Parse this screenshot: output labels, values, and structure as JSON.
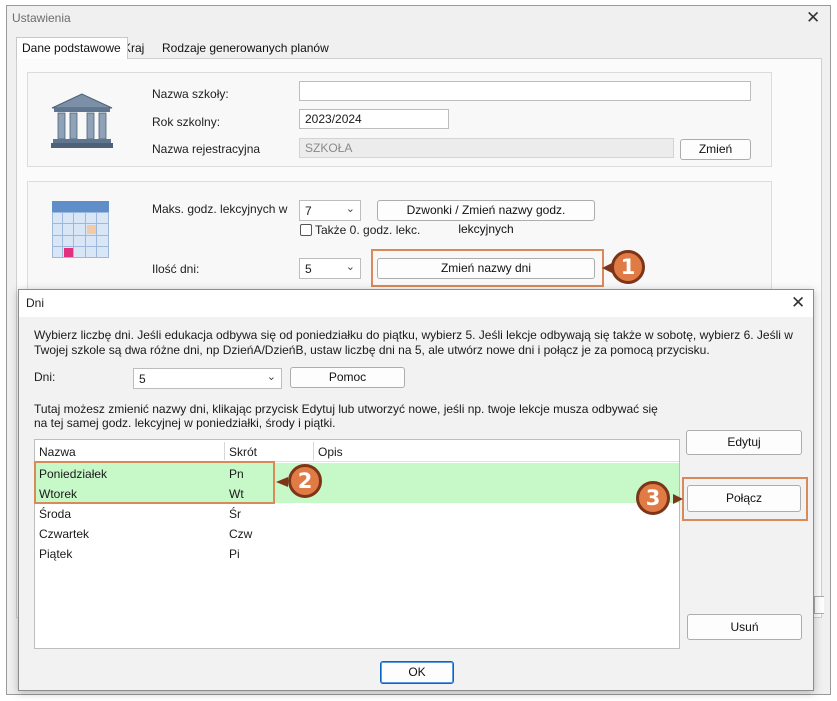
{
  "window": {
    "title": "Ustawienia",
    "close_glyph": "✕"
  },
  "tabs": [
    {
      "label": "Dane podstawowe",
      "active": true
    },
    {
      "label": "Kraj",
      "active": false
    },
    {
      "label": "Rodzaje generowanych planów",
      "active": false
    }
  ],
  "school_group": {
    "name_label": "Nazwa szkoły:",
    "name_value": "",
    "year_label": "Rok szkolny:",
    "year_value": "2023/2024",
    "reg_label": "Nazwa rejestracyjna",
    "reg_value": "SZKOŁA",
    "change_button": "Zmień",
    "icon": "building-icon"
  },
  "lessons_group": {
    "icon": "calendar-grid-icon",
    "max_label": "Maks. godz. lekcyjnych w",
    "max_value": "7",
    "bells_button": "Dzwonki / Zmień nazwy godz. lekcyjnych",
    "zero_checkbox_label": "Także 0. godz. lekc.",
    "zero_checked": false,
    "days_label": "Ilość dni:",
    "days_value": "5",
    "rename_days_button": "Zmień nazwy dni"
  },
  "annotations": {
    "badge1": "1",
    "badge2": "2",
    "badge3": "3",
    "accent_color": "#e07b45"
  },
  "dialog": {
    "title": "Dni",
    "close_glyph": "✕",
    "instructions": "Wybierz liczbę dni. Jeśli edukacja odbywa się od poniedziałku do piątku, wybierz 5. Jeśli lekcje odbywają się także w sobotę, wybierz 6. Jeśli w Twojej szkole są dwa różne dni, np DzieńA/DzieńB, ustaw liczbę dni na 5, ale utwórz nowe dni i połącz je za pomocą przycisku.",
    "days_label": "Dni:",
    "days_value": "5",
    "help_button": "Pomoc",
    "rename_hint": "Tutaj możesz zmienić nazwy dni, klikając przycisk Edytuj lub utworzyć nowe, jeśli np. twoje lekcje musza odbywać się na tej samej godz. lekcyjnej w poniedziałki, środy i piątki.",
    "columns": [
      "Nazwa",
      "Skrót",
      "Opis"
    ],
    "rows": [
      {
        "name": "Poniedziałek",
        "short": "Pn",
        "desc": "",
        "selected": true
      },
      {
        "name": "Wtorek",
        "short": "Wt",
        "desc": "",
        "selected": true
      },
      {
        "name": "Środa",
        "short": "Śr",
        "desc": "",
        "selected": false
      },
      {
        "name": "Czwartek",
        "short": "Czw",
        "desc": "",
        "selected": false
      },
      {
        "name": "Piątek",
        "short": "Pi",
        "desc": "",
        "selected": false
      }
    ],
    "edit_button": "Edytuj",
    "merge_button": "Połącz",
    "delete_button": "Usuń",
    "ok_button": "OK",
    "selection_color": "#c6f8c8"
  }
}
